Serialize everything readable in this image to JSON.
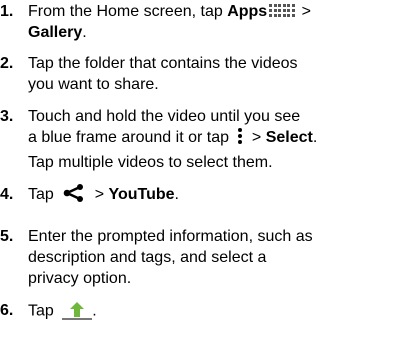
{
  "steps": [
    {
      "num": "1.",
      "prefix": "From the Home screen, tap ",
      "apps": "Apps",
      "sep": " >",
      "gallery": "Gallery",
      "end": "."
    },
    {
      "num": "2.",
      "line1": "Tap the folder that contains the videos",
      "line2": "you want to share."
    },
    {
      "num": "3.",
      "line1": "Touch and hold the video until you see",
      "line2a": "a blue frame around it or tap ",
      "line2b": " > ",
      "select": "Select",
      "end": ".",
      "line3": "Tap multiple videos to select them."
    },
    {
      "num": "4.",
      "prefix": "Tap ",
      "sep": " > ",
      "youtube": "YouTube",
      "end": "."
    },
    {
      "num": "5.",
      "line1": "Enter the prompted information, such as",
      "line2": "description and tags, and select a",
      "line3": "privacy option."
    },
    {
      "num": "6.",
      "prefix": "Tap ",
      "end": "."
    }
  ],
  "icons": {
    "apps": "apps-grid-icon",
    "menu": "menu-dots-icon",
    "share": "share-icon",
    "upload": "upload-icon",
    "accent": "#6fb83b"
  }
}
